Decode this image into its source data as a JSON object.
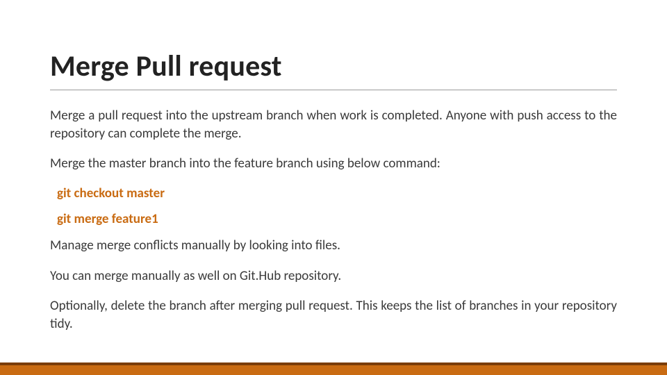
{
  "title": "Merge Pull request",
  "p1": "Merge a pull request into the upstream branch when work is completed. Anyone with push access to the repository can complete the merge.",
  "p2": "Merge the master branch into the feature branch using below command:",
  "cmd1": "git checkout master",
  "cmd2": "git merge feature1",
  "p3": "Manage merge conflicts manually by looking into files.",
  "p4": "You can merge manually as well on Git.Hub repository.",
  "p5": "Optionally, delete the branch after merging pull request. This keeps the list of branches in your repository tidy."
}
